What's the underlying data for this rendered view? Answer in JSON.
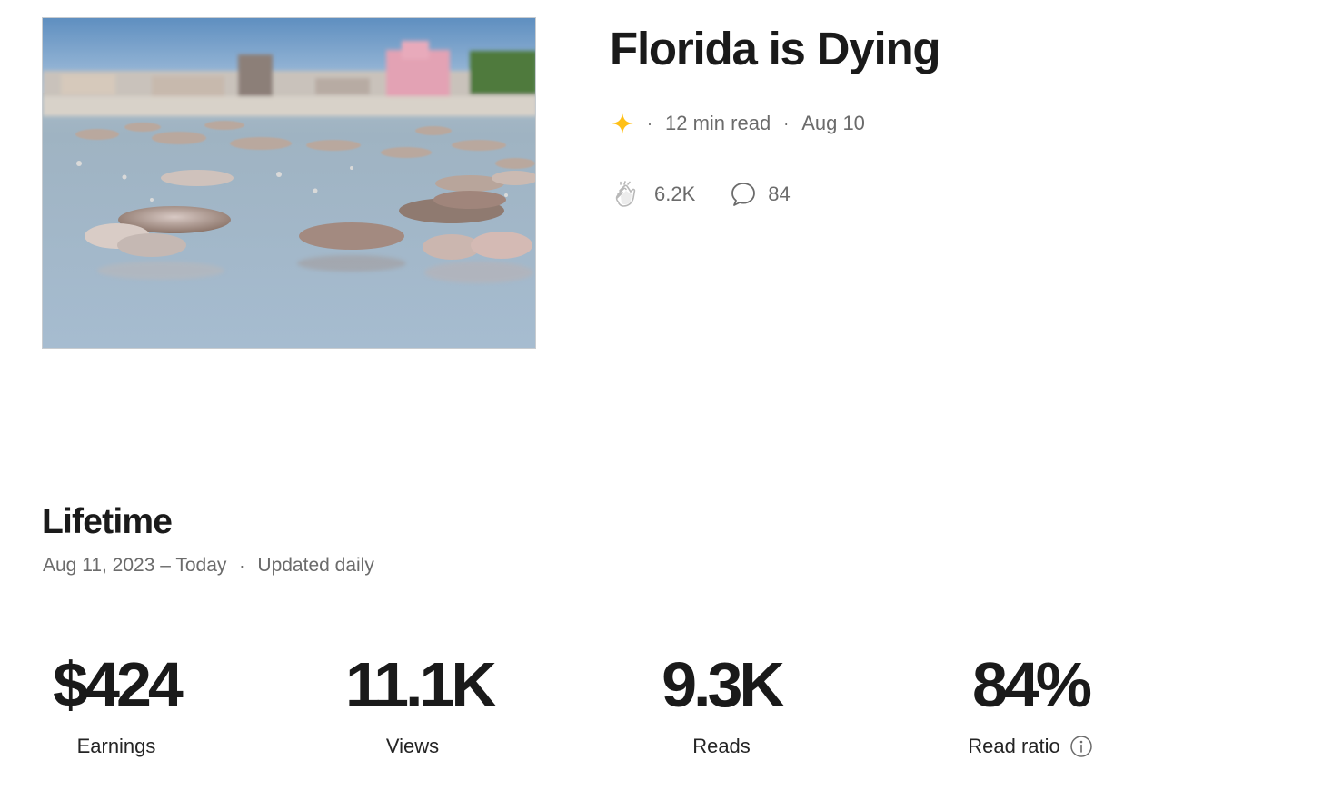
{
  "story": {
    "title": "Florida is Dying",
    "image_icon": "photo-dead-fish-on-beach",
    "meta": {
      "member_icon": "star-icon",
      "member_color": "#FFC017",
      "read_time": "12 min read",
      "date": "Aug 10"
    },
    "engagement": {
      "clap_icon": "clap-icon",
      "claps": "6.2K",
      "comment_icon": "comment-icon",
      "comments": "84"
    }
  },
  "lifetime": {
    "title": "Lifetime",
    "range": "Aug 11, 2023 – Today",
    "updated": "Updated daily",
    "stats": [
      {
        "value": "$424",
        "label": "Earnings"
      },
      {
        "value": "11.1K",
        "label": "Views"
      },
      {
        "value": "9.3K",
        "label": "Reads"
      },
      {
        "value": "84%",
        "label": "Read ratio",
        "icon": "info-icon"
      }
    ]
  },
  "colors": {
    "text_primary": "#1a1a1a",
    "text_secondary": "#6b6b6b",
    "accent_star": "#FFC017"
  }
}
